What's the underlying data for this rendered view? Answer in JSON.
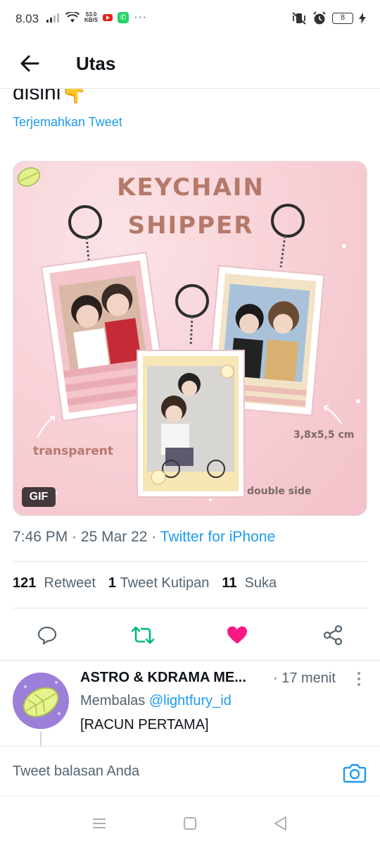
{
  "status_bar": {
    "time": "8.03",
    "net_speed_value": "53.0",
    "net_speed_unit": "KB/S",
    "battery": "8"
  },
  "header": {
    "title": "Utas"
  },
  "tweet": {
    "text_fragment": "disini👇",
    "translate_label": "Terjemahkan Tweet",
    "media_badge": "GIF",
    "media_overlay": {
      "title_line1": "KEYCHAIN",
      "title_line2": "SHIPPER",
      "label_left": "transparent",
      "label_right": "3,8x5,5 cm",
      "label_bottom": "double side"
    },
    "time": "7:46 PM",
    "date": "25 Mar 22",
    "source": "Twitter for iPhone",
    "stats": {
      "retweets_count": "121",
      "retweets_label": "Retweet",
      "quotes_count": "1",
      "quotes_label": "Tweet Kutipan",
      "likes_count": "11",
      "likes_label": "Suka"
    }
  },
  "reply": {
    "name": "ASTRO & KDRAMA ME...",
    "time": "· 17 menit",
    "replying_prefix": "Membalas",
    "replying_to": "@lightfury_id",
    "text": "[RACUN PERTAMA]"
  },
  "composer": {
    "placeholder": "Tweet balasan Anda"
  },
  "colors": {
    "accent": "#1d9bf0",
    "retweet_green": "#00ba7c",
    "like_pink": "#f91880",
    "keychain_title": "#b5796a"
  }
}
